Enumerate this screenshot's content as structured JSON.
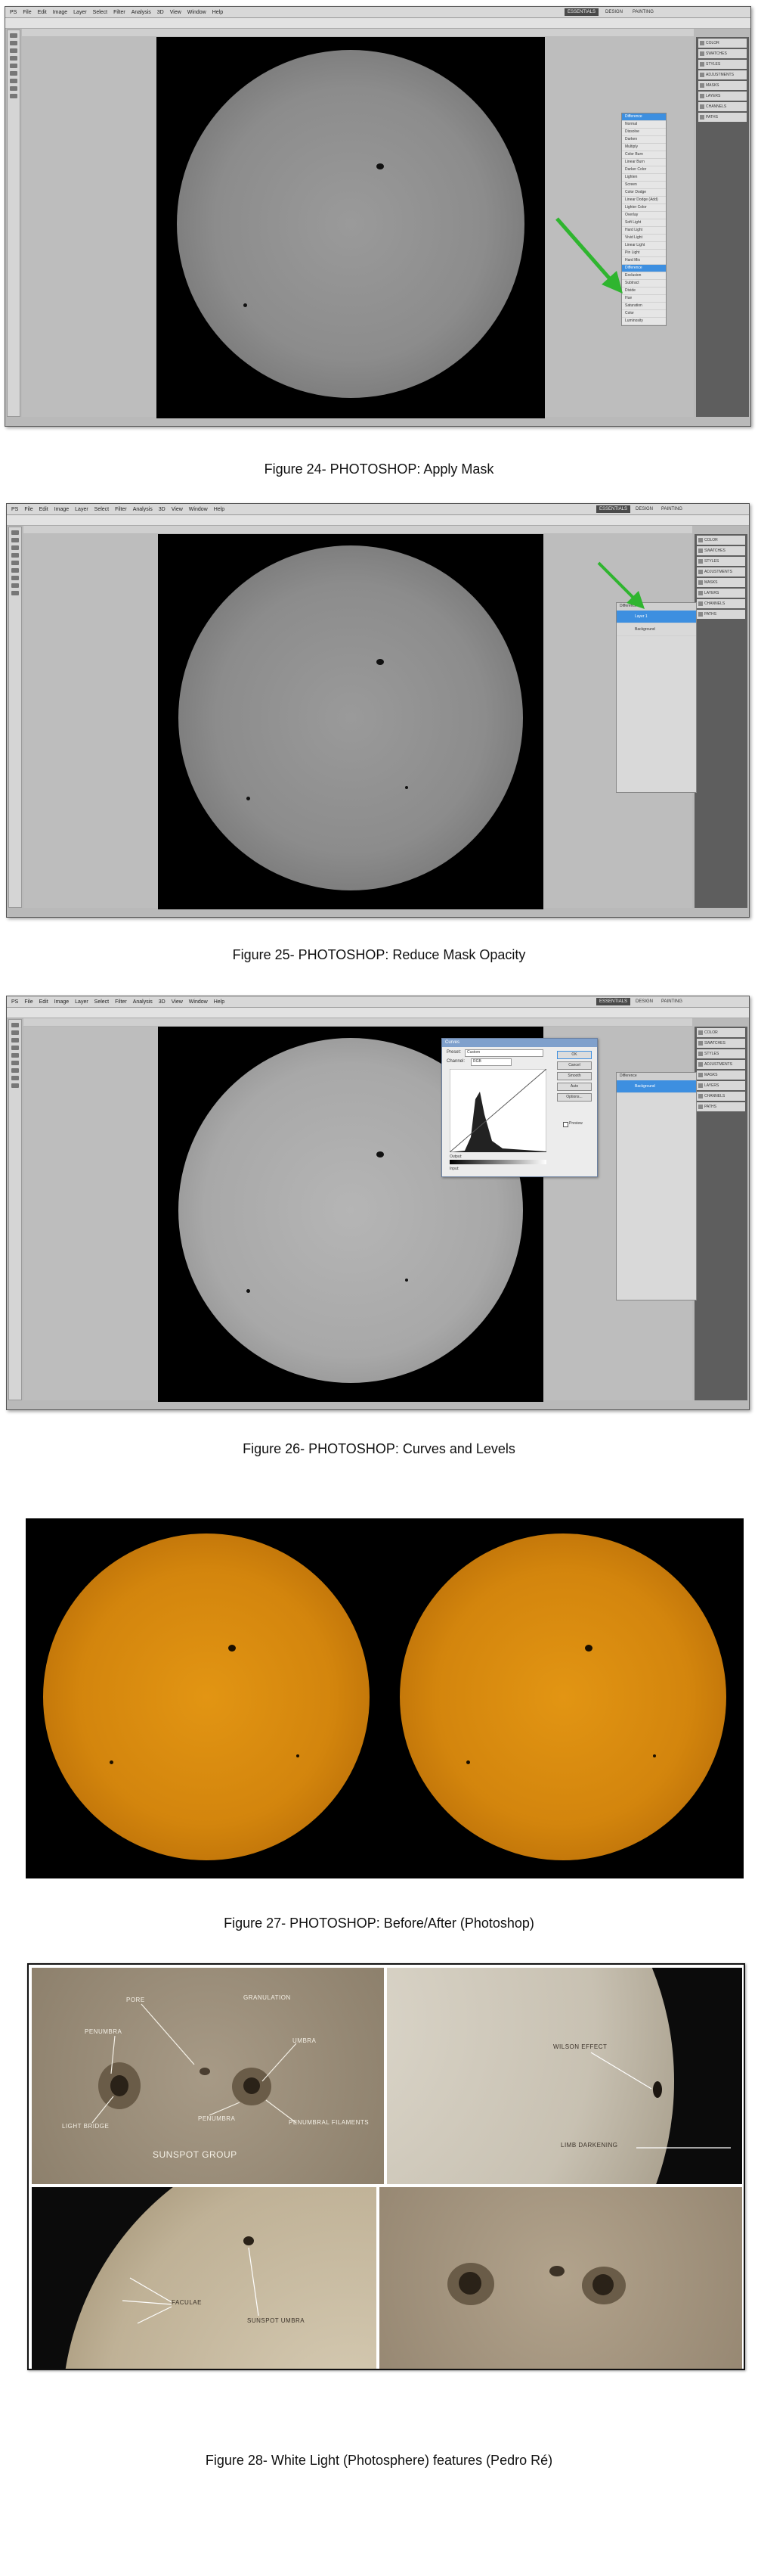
{
  "ps_menu": [
    "PS",
    "File",
    "Edit",
    "Image",
    "Layer",
    "Select",
    "Filter",
    "Analysis",
    "3D",
    "View",
    "Window",
    "Help"
  ],
  "ps_workspaces": [
    "ESSENTIALS",
    "DESIGN",
    "PAINTING"
  ],
  "ps_dock": [
    "COLOR",
    "SWATCHES",
    "STYLES",
    "ADJUSTMENTS",
    "MASKS",
    "LAYERS",
    "CHANNELS",
    "PATHS"
  ],
  "fig24": {
    "caption": "Figure 24- PHOTOSHOP: Apply Mask",
    "blend_modes": [
      "Difference",
      "Normal",
      "Dissolve",
      "Darken",
      "Multiply",
      "Color Burn",
      "Linear Burn",
      "Darker Color",
      "Lighten",
      "Screen",
      "Color Dodge",
      "Linear Dodge (Add)",
      "Lighter Color",
      "Overlay",
      "Soft Light",
      "Hard Light",
      "Vivid Light",
      "Linear Light",
      "Pin Light",
      "Hard Mix",
      "Difference",
      "Exclusion",
      "Subtract",
      "Divide",
      "Hue",
      "Saturation",
      "Color",
      "Luminosity"
    ],
    "selected_mode": "Difference"
  },
  "fig25": {
    "caption": "Figure 25- PHOTOSHOP: Reduce Mask Opacity",
    "layers": [
      "Layer 1",
      "Background"
    ]
  },
  "fig26": {
    "caption": "Figure 26- PHOTOSHOP: Curves and Levels",
    "dialog_title": "Curves",
    "preset_label": "Preset:",
    "preset_value": "Custom",
    "channel_label": "Channel:",
    "channel_value": "RGB",
    "buttons": [
      "OK",
      "Cancel",
      "Smooth",
      "Auto",
      "Options..."
    ],
    "preview_label": "Preview",
    "output_label": "Output:",
    "input_label": "Input:",
    "layers": [
      "Background"
    ]
  },
  "fig27": {
    "caption": "Figure 27- PHOTOSHOP: Before/After (Photoshop)"
  },
  "fig28": {
    "caption": "Figure 28- White Light (Photosphere) features (Pedro Ré)",
    "tile1_labels": [
      "PORE",
      "GRANULATION",
      "PENUMBRA",
      "UMBRA",
      "PENUMBRA",
      "LIGHT BRIDGE",
      "PENUMBRAL FILAMENTS"
    ],
    "tile1_title": "SUNSPOT GROUP",
    "tile2_labels": [
      "WILSON EFFECT",
      "LIMB DARKENING"
    ],
    "tile3_labels": [
      "FACULAE",
      "SUNSPOT UMBRA"
    ]
  }
}
